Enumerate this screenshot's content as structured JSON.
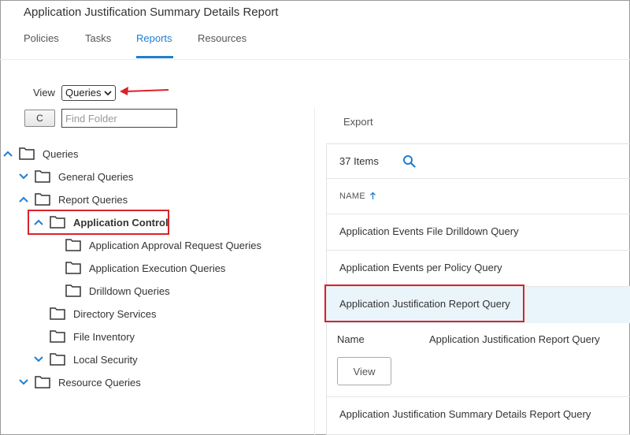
{
  "header": {
    "title": "Application Justification Summary Details Report"
  },
  "tabs": [
    {
      "label": "Policies"
    },
    {
      "label": "Tasks"
    },
    {
      "label": "Reports"
    },
    {
      "label": "Resources"
    }
  ],
  "active_tab": "Reports",
  "view": {
    "label": "View",
    "selected": "Queries"
  },
  "toolbar": {
    "refresh_label": "C",
    "find_placeholder": "Find Folder"
  },
  "tree": [
    {
      "label": "Queries",
      "expanded": true
    },
    {
      "label": "General Queries",
      "expanded": false
    },
    {
      "label": "Report Queries",
      "expanded": true
    },
    {
      "label": "Application Control",
      "expanded": true
    },
    {
      "label": "Application Approval Request Queries"
    },
    {
      "label": "Application Execution Queries"
    },
    {
      "label": "Drilldown Queries"
    },
    {
      "label": "Directory Services"
    },
    {
      "label": "File Inventory"
    },
    {
      "label": "Local Security",
      "expanded": false
    },
    {
      "label": "Resource Queries",
      "expanded": false
    }
  ],
  "right_panel": {
    "export_label": "Export",
    "items_count": "37 Items",
    "column_header": "NAME",
    "rows": [
      "Application Events File Drilldown Query",
      "Application Events per Policy Query",
      "Application Justification Report Query",
      "Application Justification Summary Details Report Query"
    ],
    "detail": {
      "label": "Name",
      "value": "Application Justification Report Query",
      "view_button": "View"
    }
  },
  "colors": {
    "accent": "#1e7fd0",
    "highlight": "#d8232a",
    "selected_row": "#eaf4fb"
  }
}
